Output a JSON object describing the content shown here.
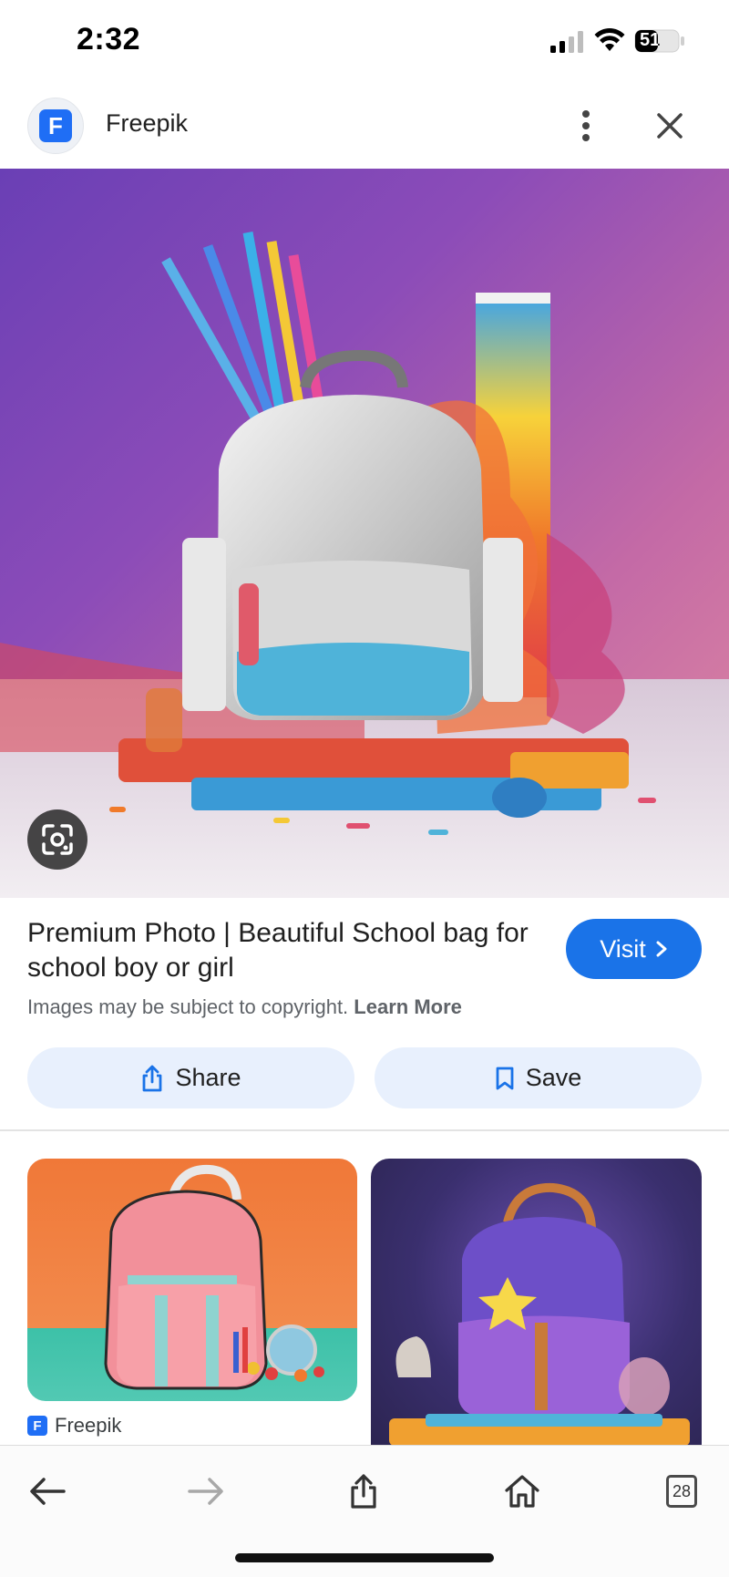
{
  "status_bar": {
    "time": "2:32",
    "battery": "51"
  },
  "header": {
    "site_name": "Freepik",
    "logo_letter": "F"
  },
  "result": {
    "title": "Premium Photo | Beautiful School bag for school boy or girl",
    "visit_label": "Visit",
    "copyright_text": "Images may be subject to copyright.",
    "learn_more": "Learn More"
  },
  "actions": {
    "share_label": "Share",
    "save_label": "Save"
  },
  "related": [
    {
      "source": "Freepik",
      "logo_letter": "F"
    }
  ],
  "toolbar": {
    "tabs_count": "28"
  },
  "colors": {
    "accent": "#1a73e8",
    "action_bg": "#e8f0fd",
    "brand": "#1f6ef5"
  }
}
